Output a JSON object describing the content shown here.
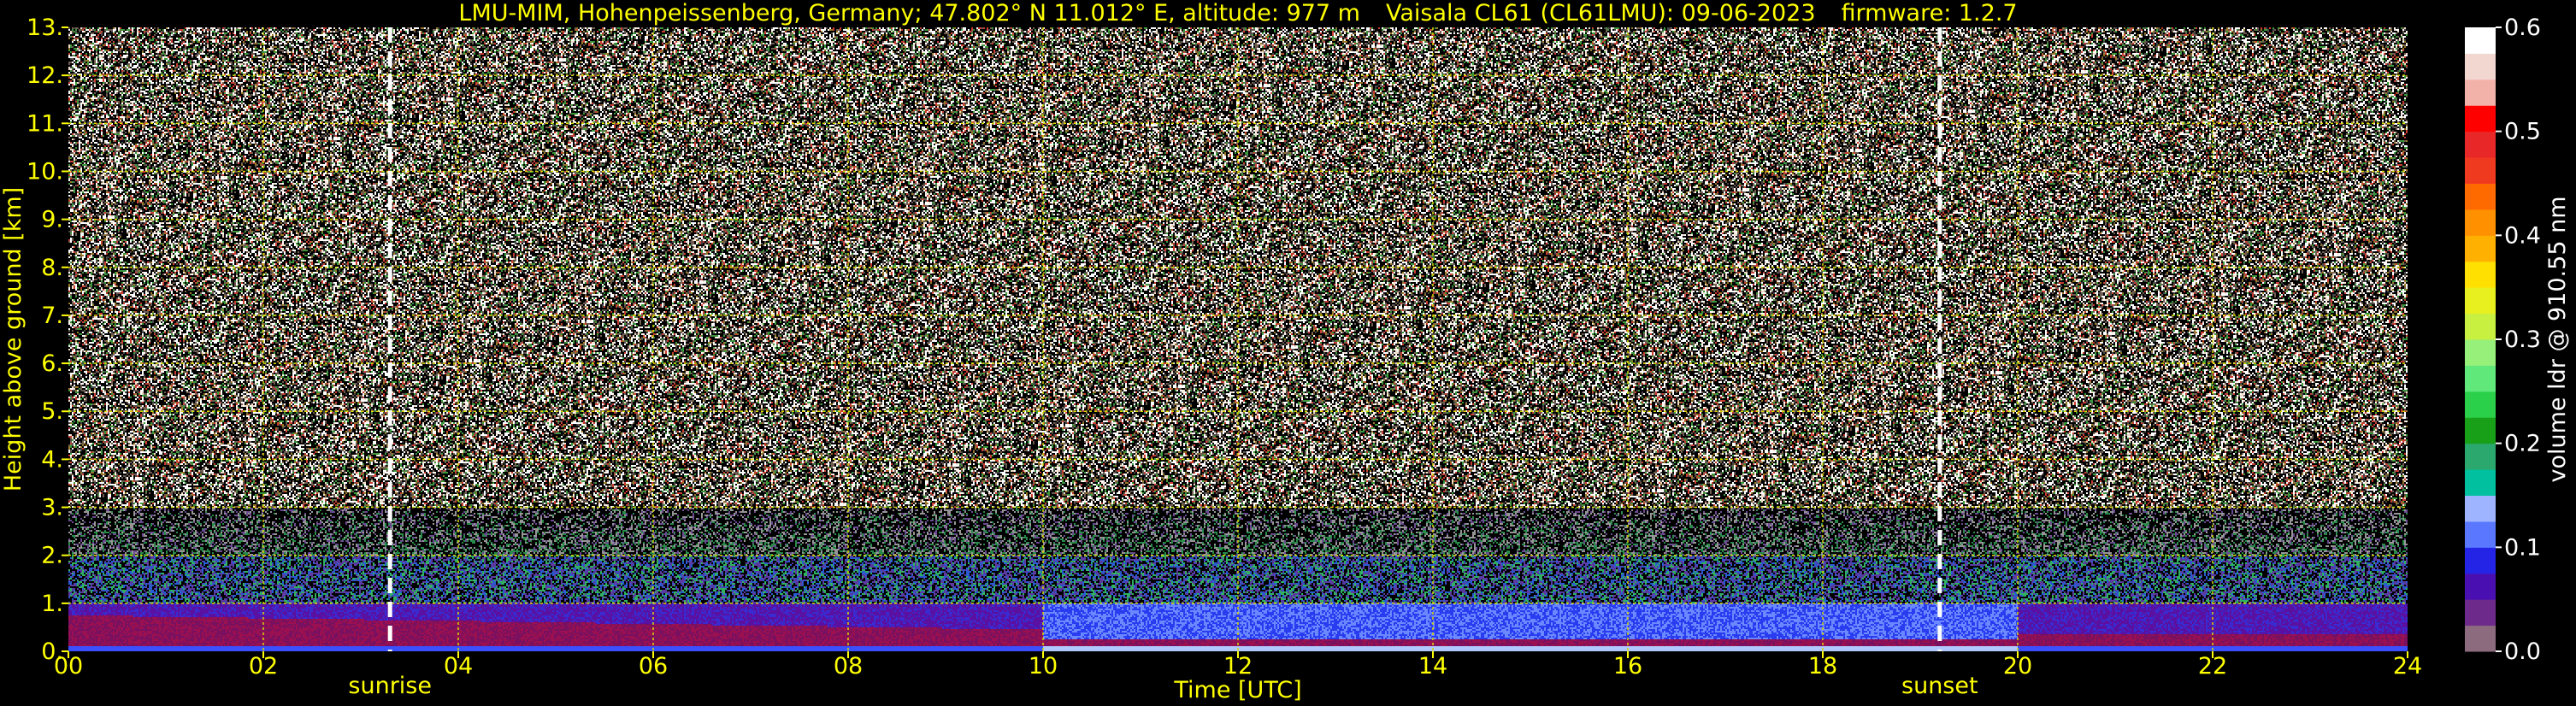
{
  "chart_data": {
    "type": "heatmap",
    "title_parts": [
      "LMU-MIM, Hohenpeissenberg, Germany; 47.802° N 11.012° E, altitude: 977 m",
      "Vaisala CL61 (CL61LMU): 09-06-2023",
      "firmware: 1.2.7"
    ],
    "xlabel": "Time [UTC]",
    "ylabel": "Height above ground [km]",
    "xlim": [
      0,
      24
    ],
    "ylim": [
      0,
      13
    ],
    "x_ticks": [
      "00",
      "02",
      "04",
      "06",
      "08",
      "10",
      "12",
      "14",
      "16",
      "18",
      "20",
      "22",
      "24"
    ],
    "y_ticks": [
      "0.",
      "1.",
      "2.",
      "3.",
      "4.",
      "5.",
      "6.",
      "7.",
      "8.",
      "9.",
      "10.",
      "11.",
      "12.",
      "13."
    ],
    "grid": true,
    "events": [
      {
        "label": "sunrise",
        "x": 3.3
      },
      {
        "label": "sunset",
        "x": 19.2
      }
    ],
    "colorbar": {
      "label": "volume ldr @ 910.55 nm",
      "range": [
        0.0,
        0.6
      ],
      "ticks": [
        "0.0",
        "0.1",
        "0.2",
        "0.3",
        "0.4",
        "0.5",
        "0.6"
      ],
      "colors": [
        "#8c6b7e",
        "#6e2a8a",
        "#4a0fb0",
        "#2424e6",
        "#5a78ff",
        "#9fb4ff",
        "#00c0a0",
        "#2aa86e",
        "#18a018",
        "#2bd04a",
        "#60e87a",
        "#96f07a",
        "#c8f040",
        "#e8f020",
        "#ffe000",
        "#ffb000",
        "#ff9000",
        "#ff6a00",
        "#f03a20",
        "#e82828",
        "#ff0000",
        "#f2b2aa",
        "#f2d6d0",
        "#ffffff"
      ]
    },
    "noise_above_km": 3.0,
    "colors": {
      "text": "#ffff00",
      "grid": "#d8d800",
      "event_line": "#ffffff"
    }
  }
}
